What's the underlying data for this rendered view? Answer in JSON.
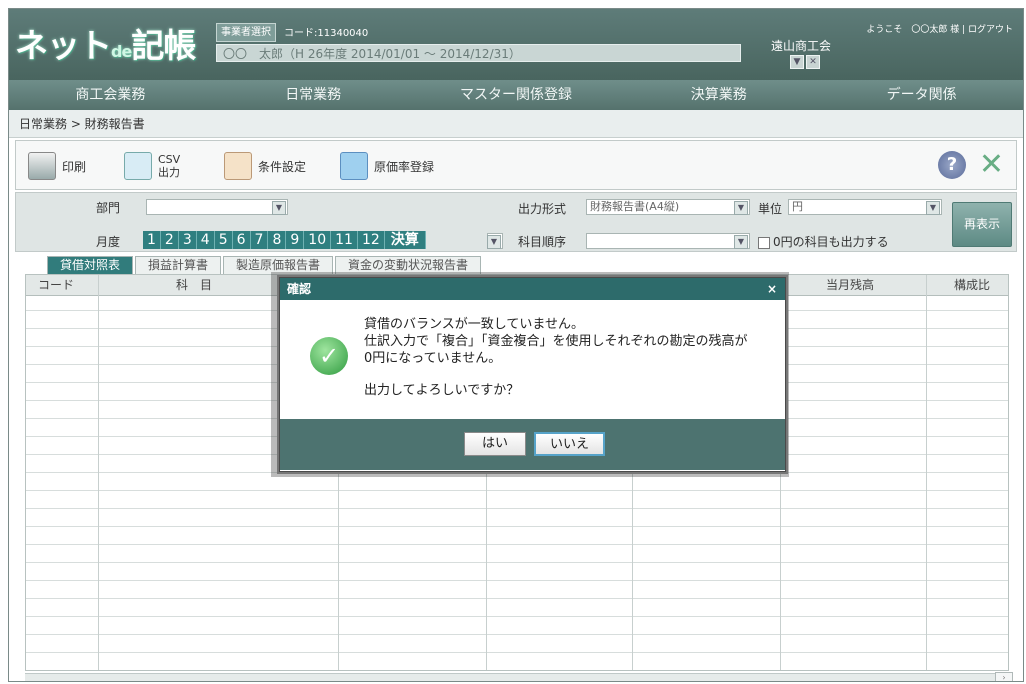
{
  "header": {
    "logo_main": "ネット",
    "logo_de": "de",
    "logo_suffix": "記帳",
    "business_select": "事業者選択",
    "code": "コード:11340040",
    "user_period": "〇〇　太郎（H 26年度 2014/01/01 ～ 2014/12/31）",
    "greeting": "ようこそ　〇〇太郎 様 | ログアウト",
    "association": "遠山商工会"
  },
  "menu": [
    "商工会業務",
    "日常業務",
    "マスター関係登録",
    "決算業務",
    "データ関係"
  ],
  "breadcrumb": "日常業務 > 財務報告書",
  "toolbar": {
    "print": "印刷",
    "csv_top": "CSV",
    "csv_bottom": "出力",
    "conditions": "条件設定",
    "cost_rate": "原価率登録"
  },
  "filter": {
    "dept_label": "部門",
    "month_label": "月度",
    "months": [
      "1",
      "2",
      "3",
      "4",
      "5",
      "6",
      "7",
      "8",
      "9",
      "10",
      "11",
      "12"
    ],
    "settlement": "決算",
    "output_format_label": "出力形式",
    "output_format_value": "財務報告書(A4縦)",
    "unit_label": "単位",
    "unit_value": "円",
    "order_label": "科目順序",
    "zero_label": "0円の科目も出力する",
    "redisplay": "再表示"
  },
  "tabs": [
    "貸借対照表",
    "損益計算書",
    "製造原価報告書",
    "資金の変動状況報告書"
  ],
  "table": {
    "headers": [
      "コード",
      "科　目",
      "当月残高",
      "構成比"
    ]
  },
  "dialog": {
    "title": "確認",
    "close": "×",
    "line1": "貸借のバランスが一致していません。",
    "line2": "仕訳入力で「複合」「資金複合」を使用しそれぞれの勘定の残高が",
    "line3": "0円になっていません。",
    "question": "出力してよろしいですか？",
    "yes": "はい",
    "no": "いいえ"
  }
}
